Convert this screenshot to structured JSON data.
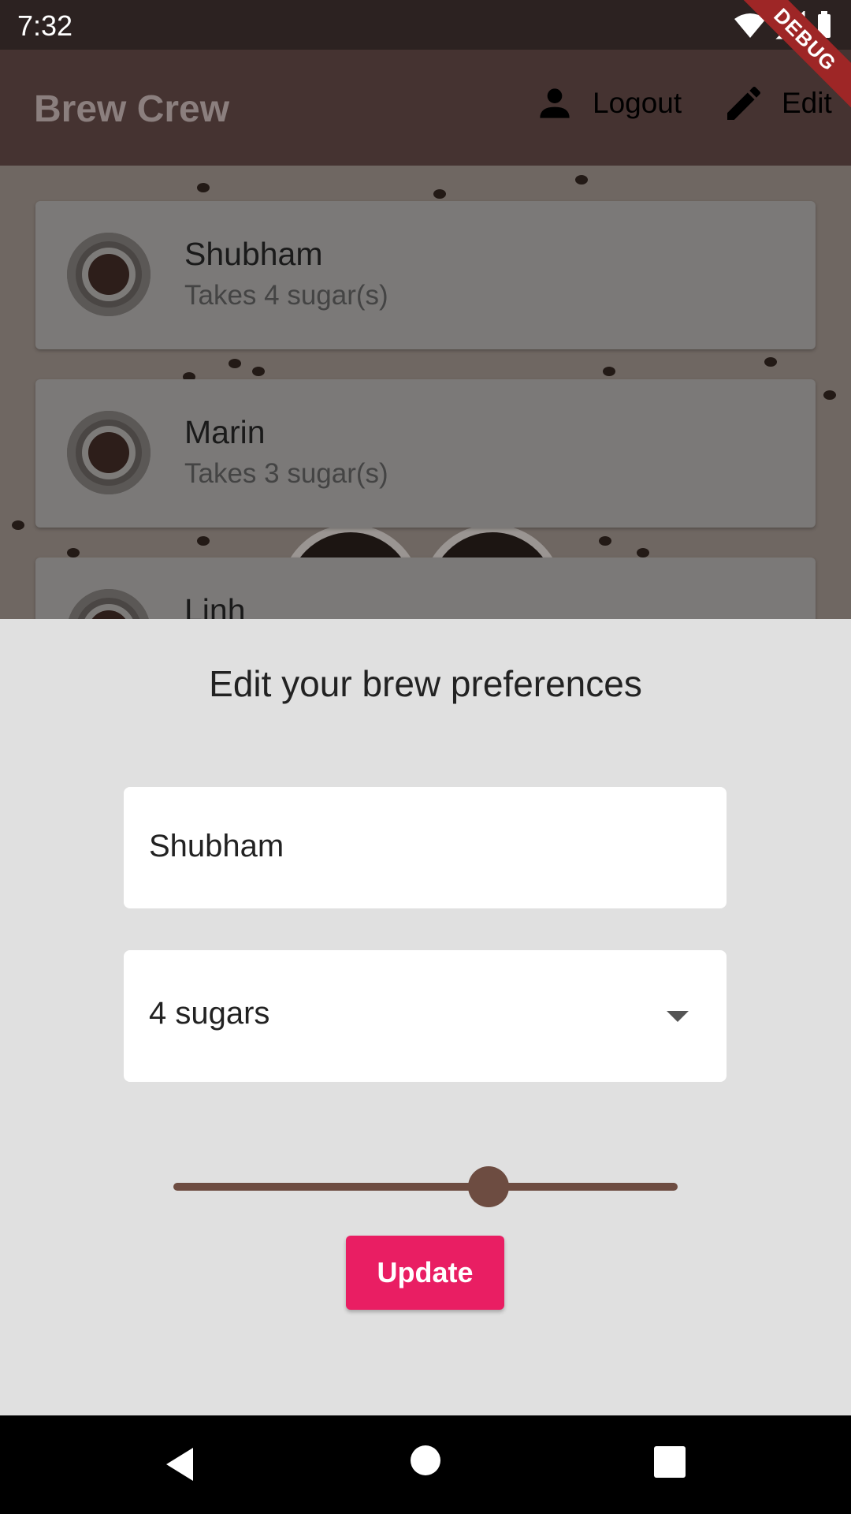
{
  "status_bar": {
    "time": "7:32",
    "debug_label": "DEBUG",
    "icons": [
      "wifi-icon",
      "signal-icon",
      "battery-icon"
    ]
  },
  "app_bar": {
    "title": "Brew Crew",
    "actions": [
      {
        "label": "Logout",
        "icon": "person-icon"
      },
      {
        "label": "Edit",
        "icon": "pencil-icon"
      }
    ]
  },
  "brews": [
    {
      "name": "Shubham",
      "subtitle": "Takes 4 sugar(s)",
      "icon": "coffee-cup-icon"
    },
    {
      "name": "Marin",
      "subtitle": "Takes 3 sugar(s)",
      "icon": "coffee-cup-icon"
    },
    {
      "name": "Linh",
      "subtitle": "",
      "icon": "coffee-cup-icon"
    }
  ],
  "sheet": {
    "title": "Edit your brew preferences",
    "name_value": "Shubham",
    "sugar_value": "4 sugars",
    "strength_fraction": 0.625,
    "update_label": "Update"
  },
  "colors": {
    "accent": "#e91e63",
    "brown": "#6d4c41",
    "app_bar": "#453331"
  },
  "nav_bar": {
    "icons": [
      "back-icon",
      "home-icon",
      "recents-icon"
    ]
  }
}
